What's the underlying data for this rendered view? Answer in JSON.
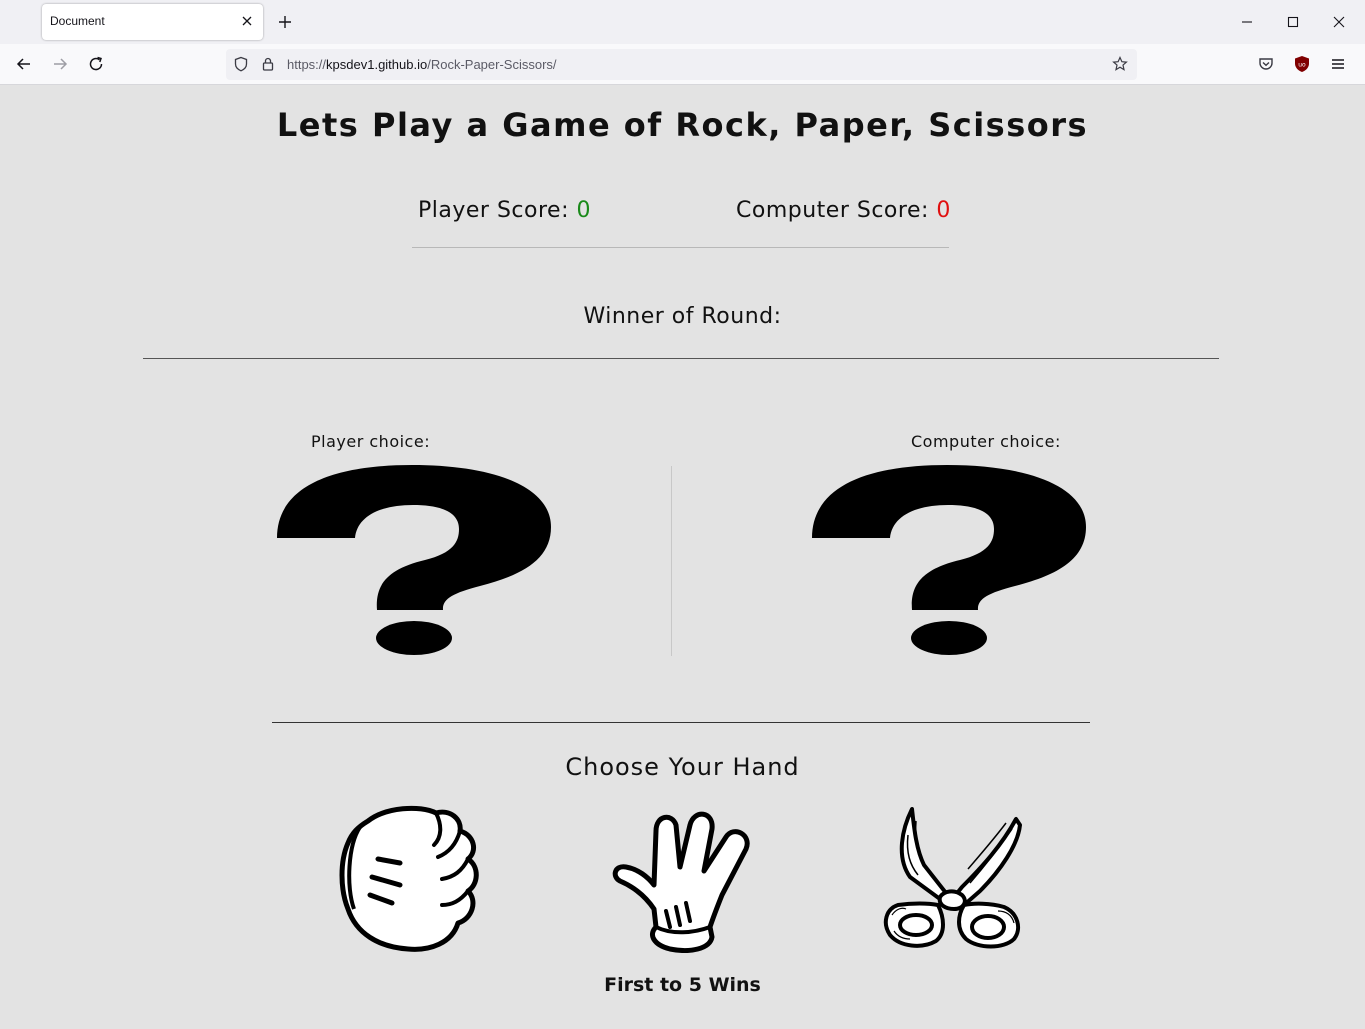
{
  "browser": {
    "tab_title": "Document",
    "url_prefix": "https://",
    "url_host": "kpsdev1.github.io",
    "url_path": "/Rock-Paper-Scissors/"
  },
  "game": {
    "title": "Lets Play a Game of Rock, Paper, Scissors",
    "player_score_label": "Player Score:",
    "player_score": "0",
    "computer_score_label": "Computer Score:",
    "computer_score": "0",
    "winner_label": "Winner of Round:",
    "player_choice_label": "Player choice:",
    "computer_choice_label": "Computer choice:",
    "choose_label": "Choose Your Hand",
    "hands": [
      "rock-hand-icon",
      "paper-hand-icon",
      "scissors-icon"
    ],
    "footer": "First to 5 Wins"
  },
  "colors": {
    "player_score": "#1a8a1a",
    "computer_score": "#e01010",
    "background": "#e3e3e3"
  }
}
